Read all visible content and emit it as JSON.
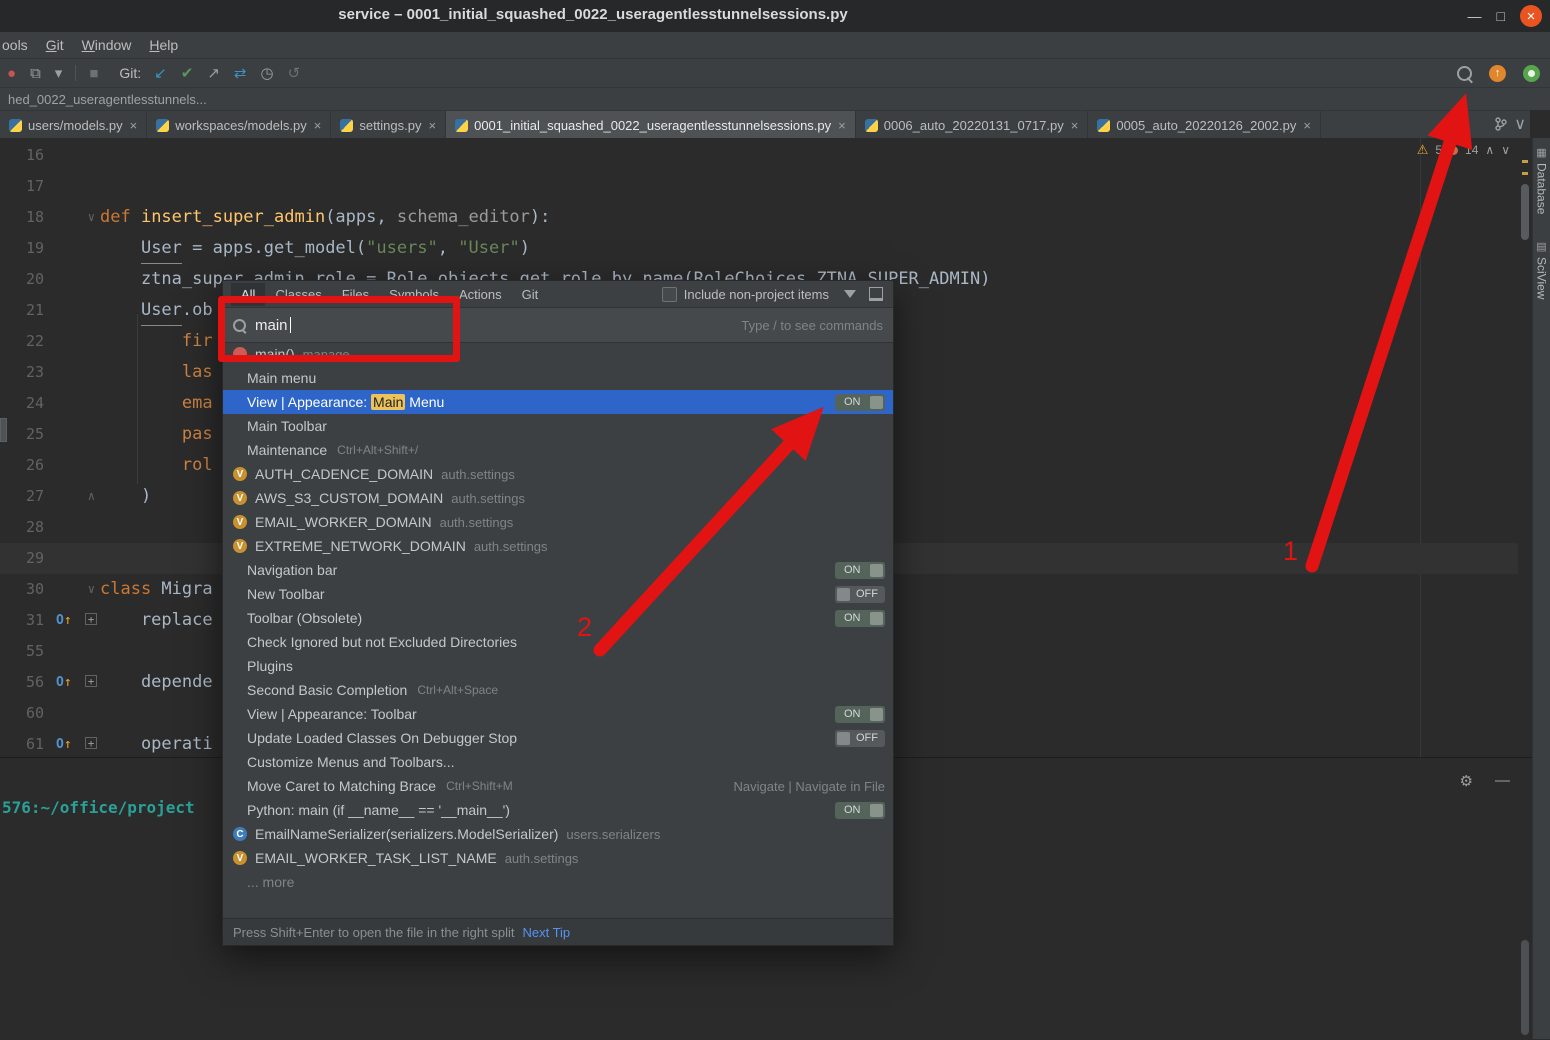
{
  "titlebar": {
    "title": "service – 0001_initial_squashed_0022_useragentlesstunnelsessions.py"
  },
  "menu": {
    "items": [
      {
        "pre": "ools"
      },
      {
        "u": "G",
        "rest": "it"
      },
      {
        "u": "W",
        "rest": "indow"
      },
      {
        "u": "H",
        "rest": "elp"
      }
    ]
  },
  "toolbar": {
    "git_label": "Git:"
  },
  "navbar": {
    "path": "hed_0022_useragentlesstunnels..."
  },
  "tabs": [
    {
      "label": "users/models.py"
    },
    {
      "label": "workspaces/models.py"
    },
    {
      "label": "settings.py"
    },
    {
      "label": "0001_initial_squashed_0022_useragentlesstunnelsessions.py"
    },
    {
      "label": "0006_auto_20220131_0717.py"
    },
    {
      "label": "0005_auto_20220126_2002.py"
    }
  ],
  "inspection": {
    "warnings": "5",
    "weak": "14"
  },
  "editor": {
    "lines": [
      {
        "num": "16"
      },
      {
        "num": "17"
      },
      {
        "num": "18",
        "s": [
          "def ",
          "insert_super_admin",
          "(apps, ",
          "schema_editor",
          "):"
        ]
      },
      {
        "num": "19",
        "s": [
          "    ",
          "User",
          " = apps.get_model(",
          "\"users\"",
          ", ",
          "\"User\"",
          ")"
        ]
      },
      {
        "num": "20",
        "s": [
          "    ztna_super_admin_role = Role.objects.get_role_by_name(RoleChoices.ZTNA_SUPER_ADMIN)"
        ]
      },
      {
        "num": "21",
        "s": [
          "    ",
          "User",
          ".ob"
        ]
      },
      {
        "num": "22",
        "s": [
          "        fir"
        ]
      },
      {
        "num": "23",
        "s": [
          "        las"
        ]
      },
      {
        "num": "24",
        "s": [
          "        ema"
        ]
      },
      {
        "num": "25",
        "s": [
          "        pas"
        ]
      },
      {
        "num": "26",
        "s": [
          "        rol"
        ]
      },
      {
        "num": "27",
        "s": [
          "    )"
        ]
      },
      {
        "num": "28"
      },
      {
        "num": "29"
      },
      {
        "num": "30",
        "s": [
          "class ",
          "Migra"
        ]
      },
      {
        "num": "31",
        "s": [
          "    replace"
        ]
      },
      {
        "num": "55"
      },
      {
        "num": "56",
        "s": [
          "    depende"
        ]
      },
      {
        "num": "60"
      },
      {
        "num": "61",
        "s": [
          "    operati"
        ]
      }
    ]
  },
  "right_stripe": {
    "database": "Database",
    "sciview": "SciView"
  },
  "terminal": {
    "prompt": "576:~/office/project"
  },
  "popup": {
    "tabs": [
      "All",
      "Classes",
      "Files",
      "Symbols",
      "Actions",
      "Git"
    ],
    "checkbox_label": "Include non-project items",
    "search": {
      "value": "main",
      "hint": "Type / to see commands"
    },
    "icon_letters": {
      "variable": "V",
      "class": "C"
    },
    "results": [
      {
        "text": "main()",
        "loc": "manage"
      },
      {
        "text": "Main menu"
      },
      {
        "pre": "View | Appearance: ",
        "match": "Main",
        "post": " Menu",
        "toggle": "ON"
      },
      {
        "text": "Main Toolbar"
      },
      {
        "text": "Maintenance",
        "shortcut": "Ctrl+Alt+Shift+/"
      },
      {
        "text": "AUTH_CADENCE_DOMAIN",
        "loc": "auth.settings"
      },
      {
        "text": "AWS_S3_CUSTOM_DOMAIN",
        "loc": "auth.settings"
      },
      {
        "text": "EMAIL_WORKER_DOMAIN",
        "loc": "auth.settings"
      },
      {
        "text": "EXTREME_NETWORK_DOMAIN",
        "loc": "auth.settings"
      },
      {
        "text": "Navigation bar",
        "toggle": "ON"
      },
      {
        "text": "New Toolbar",
        "toggle": "OFF"
      },
      {
        "text": "Toolbar (Obsolete)",
        "toggle": "ON"
      },
      {
        "text": "Check Ignored but not Excluded Directories"
      },
      {
        "text": "Plugins"
      },
      {
        "text": "Second Basic Completion",
        "shortcut": "Ctrl+Alt+Space"
      },
      {
        "text": "View | Appearance: Toolbar",
        "toggle": "ON"
      },
      {
        "text": "Update Loaded Classes On Debugger Stop",
        "toggle": "OFF"
      },
      {
        "text": "Customize Menus and Toolbars..."
      },
      {
        "text": "Move Caret to Matching Brace",
        "shortcut": "Ctrl+Shift+M",
        "right": "Navigate | Navigate in File"
      },
      {
        "text": "Python: main (if __name__ == '__main__')",
        "toggle": "ON"
      },
      {
        "text": "EmailNameSerializer(serializers.ModelSerializer)",
        "loc": "users.serializers"
      },
      {
        "text": "EMAIL_WORKER_TASK_LIST_NAME",
        "loc": "auth.settings"
      },
      {
        "text": "... more"
      }
    ],
    "footer": {
      "text": "Press Shift+Enter to open the file in the right split",
      "link": "Next Tip"
    }
  },
  "annotations": {
    "one": "1",
    "two": "2"
  },
  "icons": {
    "close": "×",
    "minimize": "—",
    "maximize": "□",
    "warning": "⚠",
    "gear": "⚙",
    "hide": "—",
    "chevron_up": "∧",
    "chevron_down": "∨",
    "fold_open": "∨",
    "fold_close": "∧",
    "plus": "+",
    "up_arrow": "↑",
    "override_o": "O",
    "git_update": "↙",
    "git_commit": "✔",
    "git_push": "↗",
    "git_compare": "⇄",
    "git_history": "◷",
    "git_rollback": "↺",
    "dropdown": "▾",
    "stop": "■",
    "copy": "⧉",
    "hotswap": "●",
    "database": "▦",
    "sciview": "▤"
  }
}
